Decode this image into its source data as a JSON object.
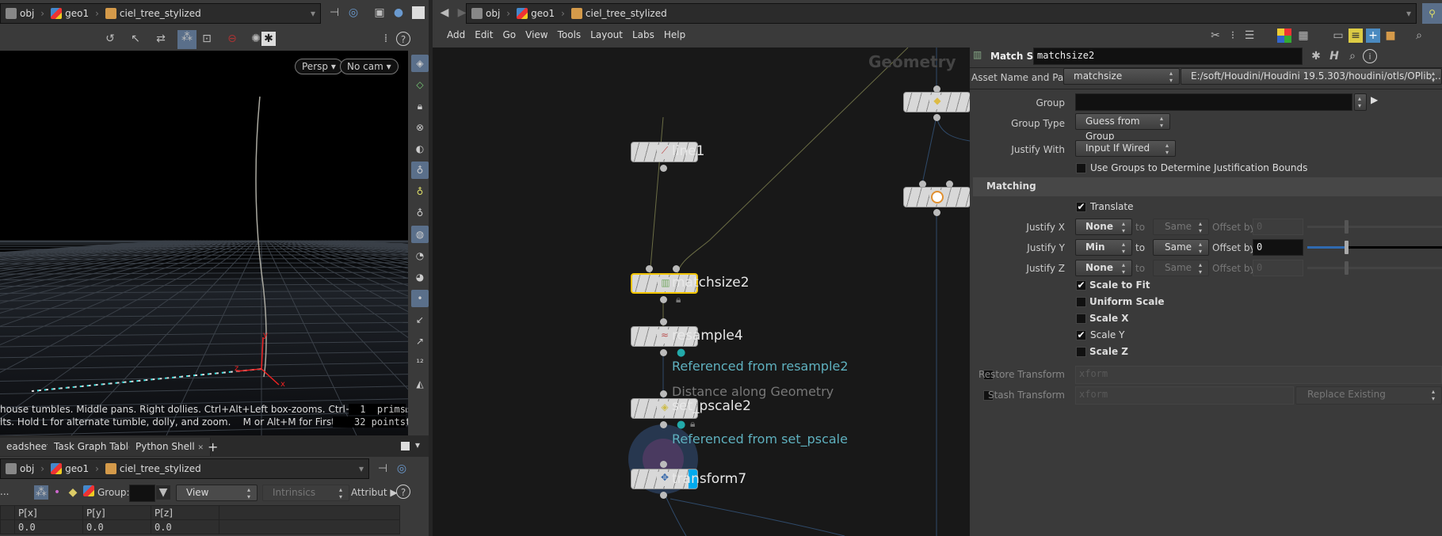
{
  "breadcrumb": {
    "obj": "obj",
    "geo": "geo1",
    "asset": "ciel_tree_stylized"
  },
  "viewport": {
    "camera": "Persp",
    "cam_menu": "No cam",
    "hint1": "house tumbles. Middle pans. Right dollies. Ctrl+Alt+Left box-zooms. Ctrl+Right zooms. Spacebar-Ctrl-",
    "hint2": "lts. Hold L for alternate tumble, dolly, and zoom.    M or Alt+M for First Person Navigation.",
    "prims": "1  prims",
    "points": "32 points",
    "axis_x": "x",
    "axis_y": "y",
    "axis_z": "z",
    "help": "?"
  },
  "bottom_tabs": [
    {
      "label": "eadsheet"
    },
    {
      "label": "Task Graph Table"
    },
    {
      "label": "Python Shell"
    }
  ],
  "spreadsheet": {
    "group_label": "Group:",
    "view": "View",
    "intrinsics": "Intrinsics",
    "attrib": "Attribut",
    "more": "...",
    "columns": [
      "P[x]",
      "P[y]",
      "P[z]"
    ],
    "rows": [
      [
        "0.0",
        "0.0",
        "0.0"
      ]
    ]
  },
  "network": {
    "menu": [
      "Add",
      "Edit",
      "Go",
      "View",
      "Tools",
      "Layout",
      "Labs",
      "Help"
    ],
    "context": "Geometry",
    "nodes": {
      "line1": "line1",
      "matchsize2": "matchsize2",
      "resample4": "resample4",
      "resample4_comment": "Referenced from resample2",
      "set_pscale2_desc": "Distance along Geometry",
      "set_pscale2": "set_pscale2",
      "set_pscale2_comment": "Referenced from set_pscale",
      "transform7": "transform7"
    }
  },
  "params": {
    "type": "Match Size",
    "name": "matchsize2",
    "asset_label": "Asset Name and Path",
    "asset": "matchsize",
    "asset_path": "E:/soft/Houdini/Houdini 19.5.303/houdini/otls/OPlib...",
    "group_label": "Group",
    "group": "",
    "group_type_label": "Group Type",
    "group_type": "Guess from Group",
    "justify_with_label": "Justify With",
    "justify_with": "Input If Wired",
    "use_groups": {
      "label": "Use Groups to Determine Justification Bounds",
      "checked": false
    },
    "matching_section": "Matching",
    "translate": {
      "label": "Translate",
      "checked": true
    },
    "justify": [
      {
        "label": "Justify X",
        "value": "None",
        "to": "to",
        "target": "Same",
        "offset_label": "Offset by",
        "offset": "0",
        "enabled": false
      },
      {
        "label": "Justify Y",
        "value": "Min",
        "to": "to",
        "target": "Same",
        "offset_label": "Offset by",
        "offset": "0",
        "enabled": true
      },
      {
        "label": "Justify Z",
        "value": "None",
        "to": "to",
        "target": "Same",
        "offset_label": "Offset by",
        "offset": "0",
        "enabled": false
      }
    ],
    "scale_to_fit": {
      "label": "Scale to Fit",
      "checked": true
    },
    "uniform_scale": {
      "label": "Uniform Scale",
      "checked": false
    },
    "scale_x": {
      "label": "Scale X",
      "checked": false
    },
    "scale_y": {
      "label": "Scale Y",
      "checked": true
    },
    "scale_z": {
      "label": "Scale Z",
      "checked": false
    },
    "restore": {
      "label": "Restore Transform",
      "value": "xform",
      "checked": false
    },
    "stash": {
      "label": "Stash Transform",
      "value": "xform",
      "mode": "Replace Existing",
      "checked": false
    }
  },
  "colors": {
    "selected_node": "#f2c400",
    "comment": "#5fb1bf",
    "wire": "#6b6d45",
    "wire_blue": "#2f4a6a",
    "display_flag": "#00aaee"
  }
}
